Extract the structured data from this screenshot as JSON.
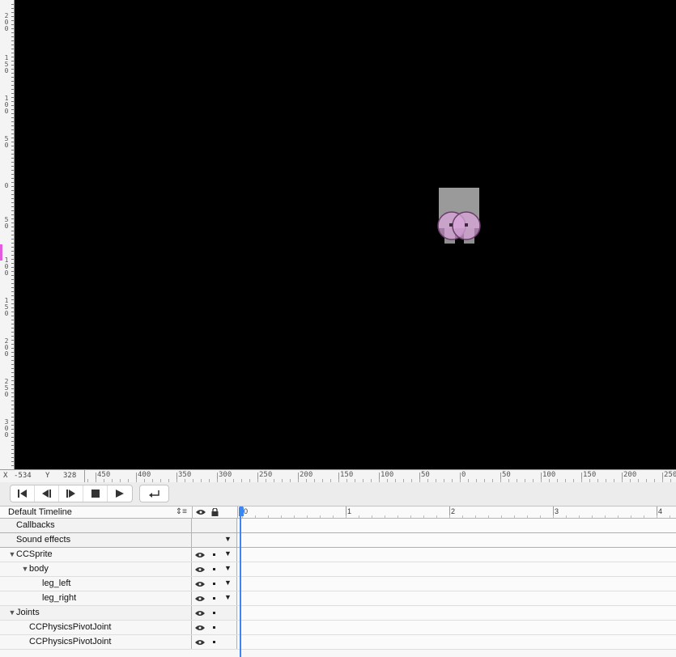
{
  "vruler": {
    "labels": [
      "2\n0\n0",
      "1\n5\n0",
      "1\n0\n0",
      "5\n0",
      "0",
      "5\n0",
      "1\n0\n0",
      "1\n5\n0",
      "2\n0\n0",
      "2\n5\n0",
      "3\n0\n0"
    ]
  },
  "coords": {
    "x_label": "X",
    "x_value": "-534",
    "y_label": "Y",
    "y_value": "328"
  },
  "hruler": {
    "labels": [
      "450",
      "400",
      "350",
      "300",
      "250",
      "200",
      "150",
      "100",
      "50",
      "0",
      "50",
      "100",
      "150",
      "200",
      "250"
    ]
  },
  "toolbar": {
    "buttons": [
      "go-to-start",
      "step-back",
      "step-forward",
      "stop",
      "play",
      "loop"
    ]
  },
  "timeline": {
    "name": "Default Timeline",
    "scale_labels": [
      "0",
      "1",
      "2",
      "3",
      "4"
    ],
    "rows": [
      {
        "label": "Callbacks",
        "indent": 1,
        "kind": "section"
      },
      {
        "label": "Sound effects",
        "indent": 1,
        "kind": "section"
      },
      {
        "label": "CCSprite",
        "indent": 0,
        "kind": "node"
      },
      {
        "label": "body",
        "indent": 1,
        "kind": "node"
      },
      {
        "label": "leg_left",
        "indent": 2,
        "kind": "node"
      },
      {
        "label": "leg_right",
        "indent": 2,
        "kind": "node"
      },
      {
        "label": "Joints",
        "indent": 0,
        "kind": "group"
      },
      {
        "label": "CCPhysicsPivotJoint",
        "indent": 2,
        "kind": "joint"
      },
      {
        "label": "CCPhysicsPivotJoint",
        "indent": 2,
        "kind": "joint"
      }
    ]
  },
  "colors": {
    "canvas": "#000000",
    "sprite_body": "#9a9a9a",
    "joint_marker": "#d79bd9",
    "playhead": "#3a86f2",
    "ruler_marker": "#e25ce2"
  }
}
